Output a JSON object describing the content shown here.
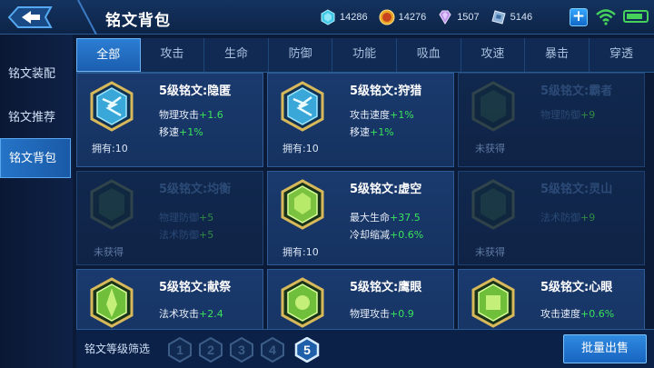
{
  "header": {
    "title": "铭文背包",
    "currencies": [
      {
        "icon": "crystal-icon",
        "value": "14286"
      },
      {
        "icon": "gold-coin-icon",
        "value": "14276"
      },
      {
        "icon": "diamond-icon",
        "value": "1507"
      },
      {
        "icon": "voucher-icon",
        "value": "5146"
      }
    ],
    "add_label": "+"
  },
  "sidebar": {
    "items": [
      {
        "label": "铭文装配",
        "active": false
      },
      {
        "label": "铭文推荐",
        "active": false
      },
      {
        "label": "铭文背包",
        "active": true
      }
    ]
  },
  "tabs": [
    "全部",
    "攻击",
    "生命",
    "防御",
    "功能",
    "吸血",
    "攻速",
    "暴击",
    "穿透"
  ],
  "active_tab": "全部",
  "cards": [
    {
      "name": "5级铭文:隐匿",
      "attrs": [
        {
          "k": "物理攻击",
          "v": "+1.6"
        },
        {
          "k": "移速",
          "v": "+1%"
        }
      ],
      "own": "拥有:10",
      "locked": false,
      "color": "blue"
    },
    {
      "name": "5级铭文:狩猎",
      "attrs": [
        {
          "k": "攻击速度",
          "v": "+1%"
        },
        {
          "k": "移速",
          "v": "+1%"
        }
      ],
      "own": "拥有:10",
      "locked": false,
      "color": "blue"
    },
    {
      "name": "5级铭文:霸者",
      "attrs": [
        {
          "k": "物理防御",
          "v": "+9"
        }
      ],
      "own": "未获得",
      "locked": true,
      "color": "green"
    },
    {
      "name": "5级铭文:均衡",
      "attrs": [
        {
          "k": "物理防御",
          "v": "+5"
        },
        {
          "k": "法术防御",
          "v": "+5"
        }
      ],
      "own": "未获得",
      "locked": true,
      "color": "green"
    },
    {
      "name": "5级铭文:虚空",
      "attrs": [
        {
          "k": "最大生命",
          "v": "+37.5"
        },
        {
          "k": "冷却缩减",
          "v": "+0.6%"
        }
      ],
      "own": "拥有:10",
      "locked": false,
      "color": "green"
    },
    {
      "name": "5级铭文:灵山",
      "attrs": [
        {
          "k": "法术防御",
          "v": "+9"
        }
      ],
      "own": "未获得",
      "locked": true,
      "color": "green"
    },
    {
      "name": "5级铭文:献祭",
      "attrs": [
        {
          "k": "法术攻击",
          "v": "+2.4"
        }
      ],
      "own": "",
      "locked": false,
      "color": "green"
    },
    {
      "name": "5级铭文:鹰眼",
      "attrs": [
        {
          "k": "物理攻击",
          "v": "+0.9"
        }
      ],
      "own": "",
      "locked": false,
      "color": "green"
    },
    {
      "name": "5级铭文:心眼",
      "attrs": [
        {
          "k": "攻击速度",
          "v": "+0.6%"
        }
      ],
      "own": "",
      "locked": false,
      "color": "green"
    }
  ],
  "footer": {
    "filter_label": "铭文等级筛选",
    "levels": [
      "1",
      "2",
      "3",
      "4",
      "5"
    ],
    "selected_level": "5",
    "sell_label": "批量出售"
  },
  "colors": {
    "accent": "#2574c7",
    "positive": "#3ae35b",
    "panel": "#1a3a6e"
  }
}
